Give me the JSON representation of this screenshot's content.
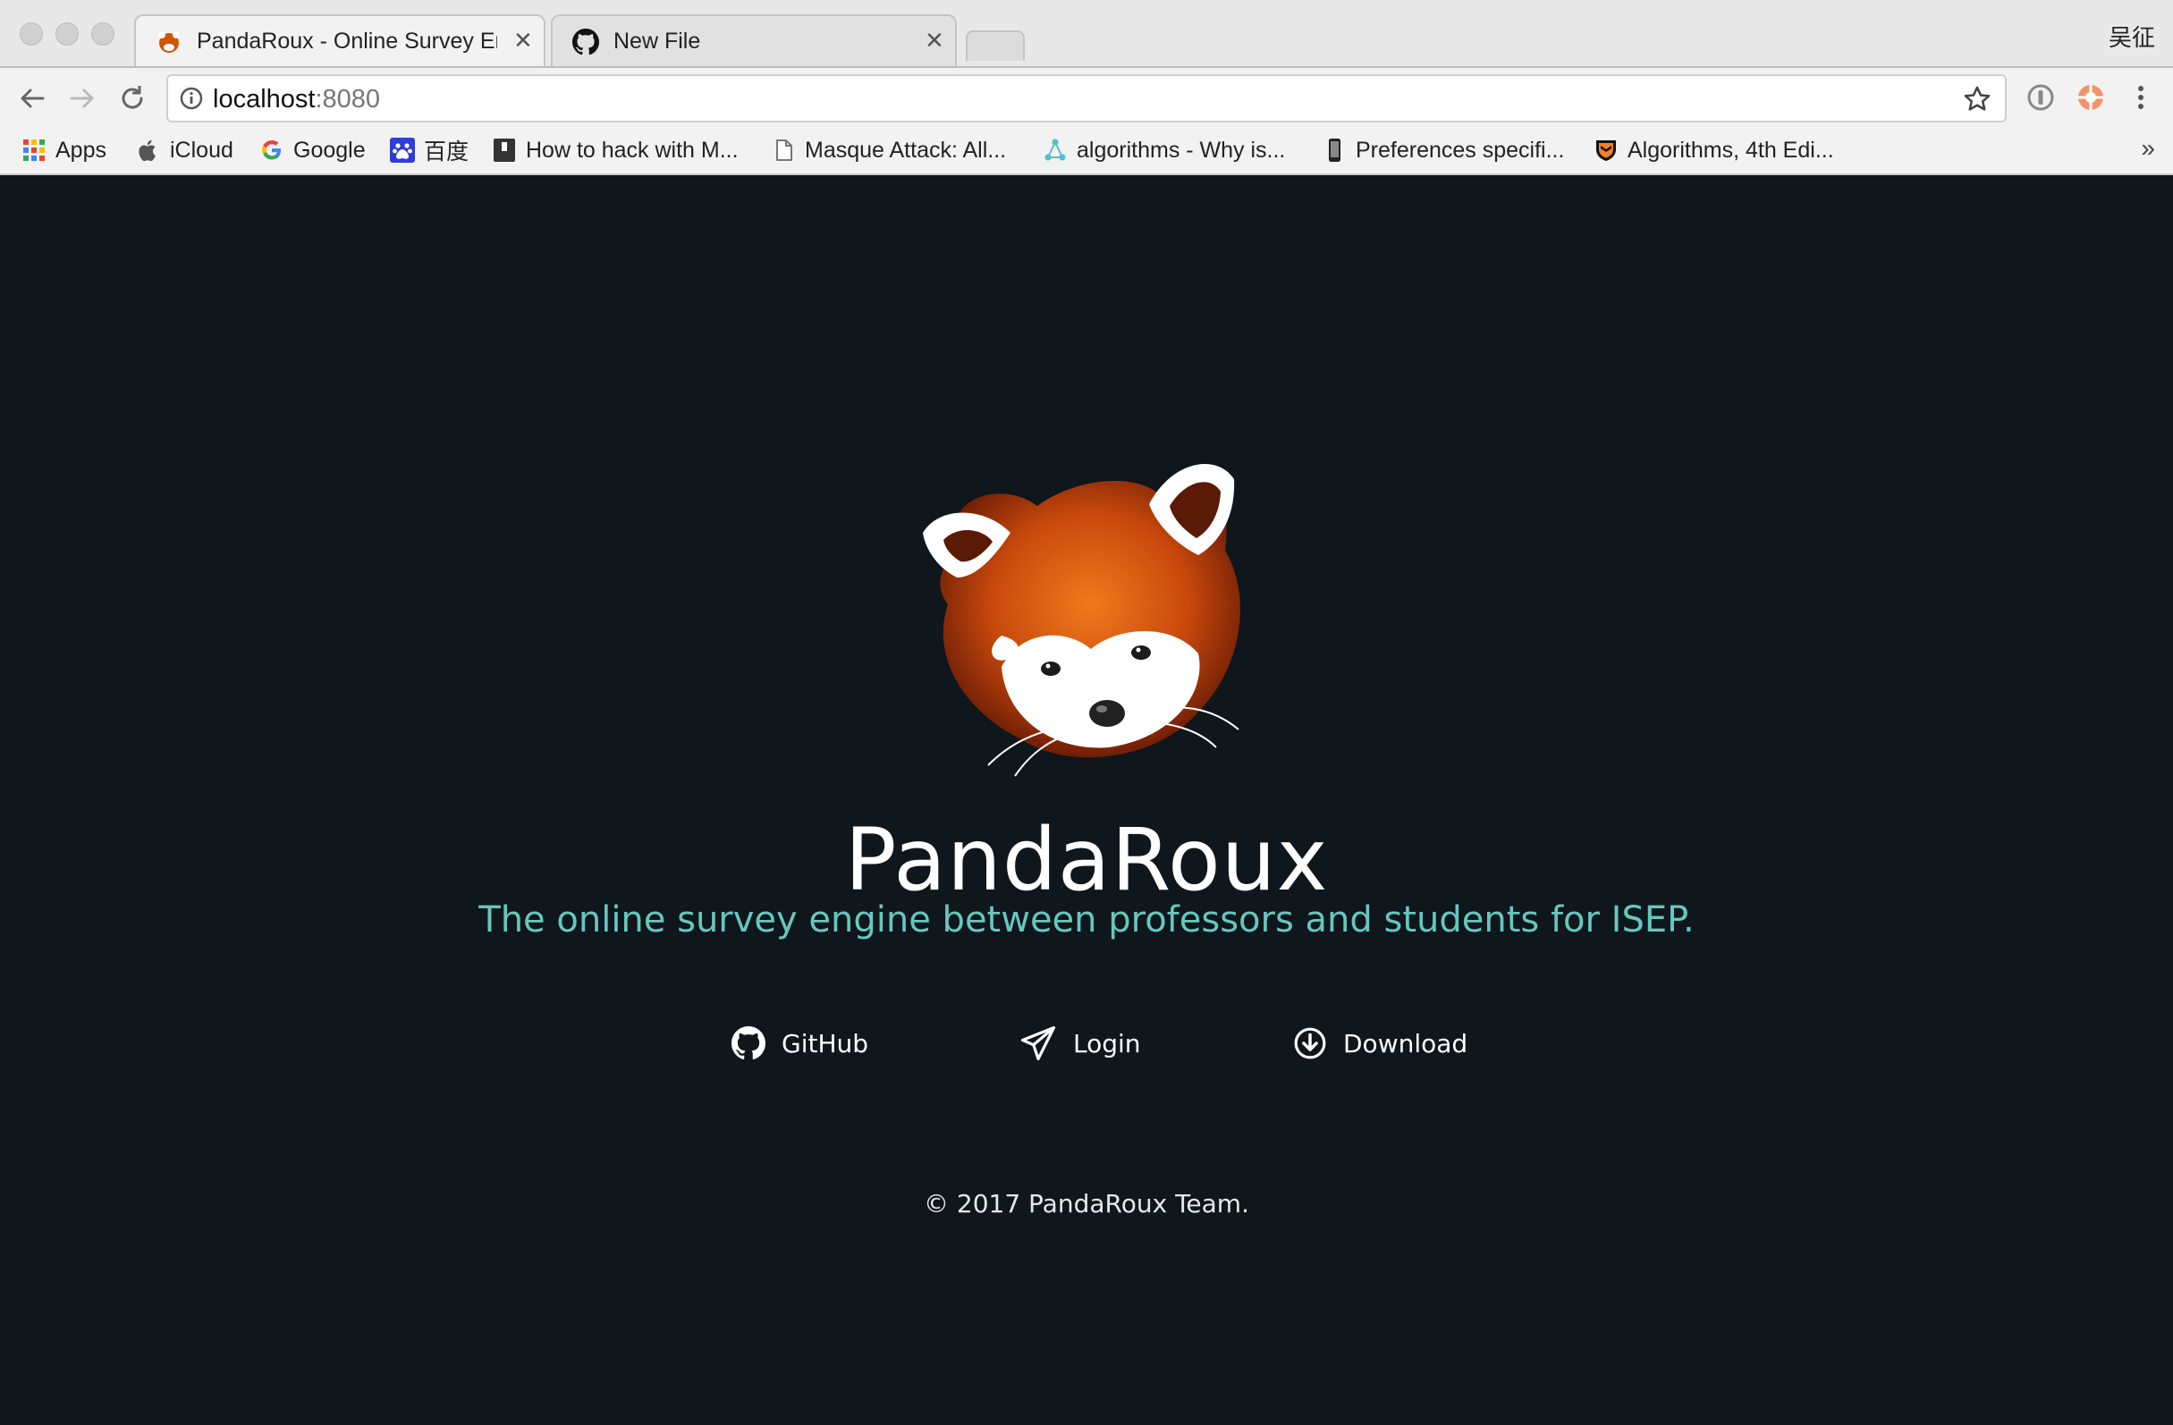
{
  "browser": {
    "tabs": [
      {
        "title": "PandaRoux - Online Survey Engine",
        "active": true
      },
      {
        "title": "New File",
        "active": false
      }
    ],
    "profile_name": "吴征",
    "address": {
      "host": "localhost",
      "port": ":8080"
    },
    "bookmarks": [
      {
        "label": "Apps",
        "icon": "apps-grid-icon"
      },
      {
        "label": "iCloud",
        "icon": "apple-icon"
      },
      {
        "label": "Google",
        "icon": "google-icon"
      },
      {
        "label": "百度",
        "icon": "baidu-icon"
      },
      {
        "label": "How to hack with M...",
        "icon": "page-dark-icon"
      },
      {
        "label": "Masque Attack: All...",
        "icon": "document-icon"
      },
      {
        "label": "algorithms - Why is...",
        "icon": "network-icon"
      },
      {
        "label": "Preferences specifi...",
        "icon": "phone-icon"
      },
      {
        "label": "Algorithms, 4th Edi...",
        "icon": "princeton-shield-icon"
      }
    ],
    "bookmarks_more": "»"
  },
  "page": {
    "title": "PandaRoux",
    "subtitle": "The online survey engine between professors and students for ISEP.",
    "actions": [
      {
        "label": "GitHub",
        "icon": "github-icon"
      },
      {
        "label": "Login",
        "icon": "paper-plane-icon"
      },
      {
        "label": "Download",
        "icon": "download-circle-icon"
      }
    ],
    "footer": "© 2017 PandaRoux Team."
  },
  "colors": {
    "page_bg": "#0f161c",
    "accent": "#66c7be",
    "text": "#ffffff"
  }
}
